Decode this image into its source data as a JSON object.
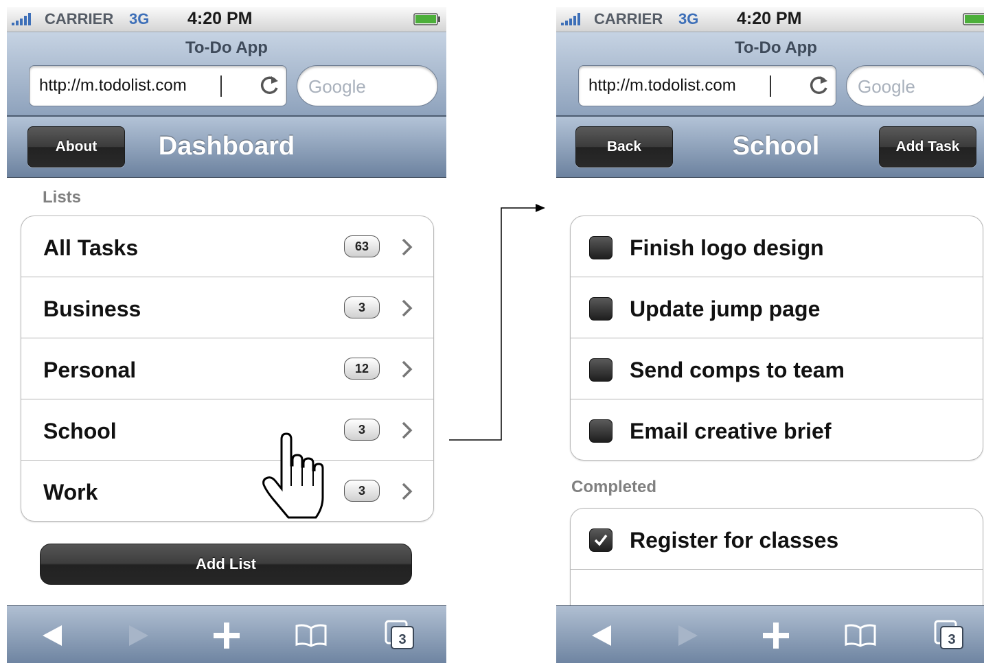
{
  "status_bar": {
    "carrier": "CARRIER",
    "network": "3G",
    "time": "4:20 PM"
  },
  "browser": {
    "page_title": "To-Do App",
    "url": "http://m.todolist.com",
    "search_placeholder": "Google"
  },
  "dashboard": {
    "nav": {
      "left_button": "About",
      "title": "Dashboard"
    },
    "section_label": "Lists",
    "lists": [
      {
        "label": "All Tasks",
        "count": "63"
      },
      {
        "label": "Business",
        "count": "3"
      },
      {
        "label": "Personal",
        "count": "12"
      },
      {
        "label": "School",
        "count": "3"
      },
      {
        "label": "Work",
        "count": "3"
      }
    ],
    "add_list_label": "Add List"
  },
  "school": {
    "nav": {
      "left_button": "Back",
      "title": "School",
      "right_button": "Add Task"
    },
    "tasks": [
      {
        "label": "Finish logo design",
        "checked": false
      },
      {
        "label": "Update jump page",
        "checked": false
      },
      {
        "label": "Send comps to team",
        "checked": false
      },
      {
        "label": "Email creative brief",
        "checked": false
      }
    ],
    "completed_label": "Completed",
    "completed": [
      {
        "label": "Register for classes",
        "checked": true
      }
    ]
  },
  "toolbar": {
    "items": [
      "back-icon",
      "forward-icon",
      "add-icon",
      "bookmarks-icon",
      "pages-icon"
    ],
    "pages_count": "3"
  },
  "colors": {
    "nav_gradient_top": "#b3c3d7",
    "nav_gradient_bottom": "#6c829f",
    "button_dark": "#2a2a2a"
  }
}
